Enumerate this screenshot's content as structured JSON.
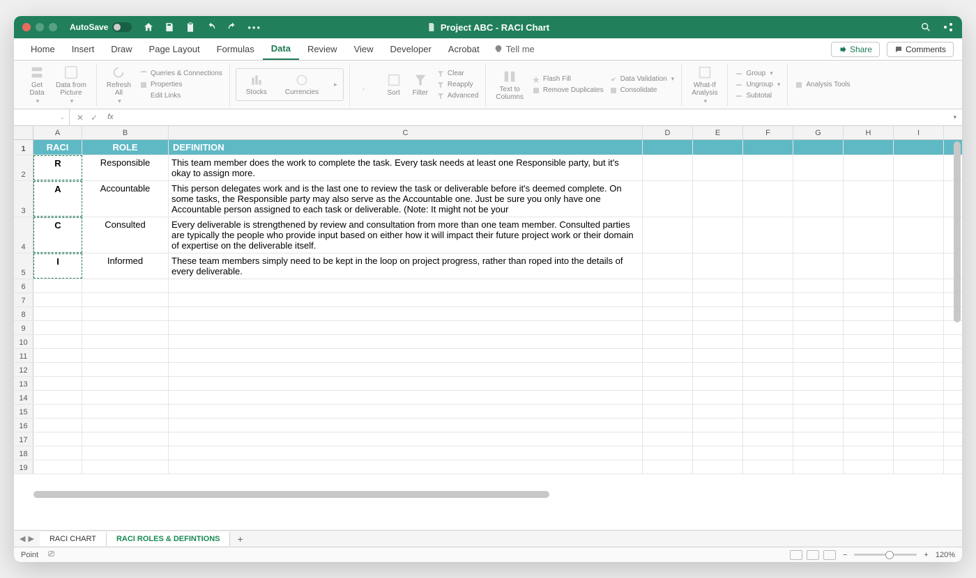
{
  "titlebar": {
    "autosave": "AutoSave",
    "title": "Project ABC - RACI Chart"
  },
  "tabs": [
    "Home",
    "Insert",
    "Draw",
    "Page Layout",
    "Formulas",
    "Data",
    "Review",
    "View",
    "Developer",
    "Acrobat"
  ],
  "active_tab": "Data",
  "tellme": "Tell me",
  "share": "Share",
  "comments": "Comments",
  "ribbon": {
    "get_data": "Get\nData",
    "from_picture": "Data from\nPicture",
    "refresh": "Refresh\nAll",
    "queries": "Queries & Connections",
    "properties": "Properties",
    "edit_links": "Edit Links",
    "stocks": "Stocks",
    "currencies": "Currencies",
    "sort": "Sort",
    "filter": "Filter",
    "clear": "Clear",
    "reapply": "Reapply",
    "advanced": "Advanced",
    "text_to_cols": "Text to\nColumns",
    "flash_fill": "Flash Fill",
    "remove_dup": "Remove Duplicates",
    "data_val": "Data Validation",
    "consolidate": "Consolidate",
    "whatif": "What-If\nAnalysis",
    "group": "Group",
    "ungroup": "Ungroup",
    "subtotal": "Subtotal",
    "analysis": "Analysis Tools"
  },
  "columns": [
    "A",
    "B",
    "C",
    "D",
    "E",
    "F",
    "G",
    "H",
    "I"
  ],
  "header_row": {
    "raci": "RACI",
    "role": "ROLE",
    "def": "DEFINITION"
  },
  "rows": [
    {
      "raci": "R",
      "role": "Responsible",
      "def": "This team member does the work to complete the task. Every task needs at least one Responsible party, but it's okay to assign more."
    },
    {
      "raci": "A",
      "role": "Accountable",
      "def": "This person delegates work and is the last one to review the task or deliverable before it's deemed complete. On some tasks, the Responsible party may also serve as the Accountable one. Just be sure you only have one Accountable person assigned to each task or deliverable. (Note: It might not be your"
    },
    {
      "raci": "C",
      "role": "Consulted",
      "def": "Every deliverable is strengthened by review and consultation from more than one team member. Consulted parties are typically the people who provide input based on either how it will impact their future project work or their domain of expertise on the deliverable itself."
    },
    {
      "raci": "I",
      "role": "Informed",
      "def": "These team members simply need to be kept in the loop on project progress, rather than roped into the details of every deliverable."
    }
  ],
  "sheets": [
    "RACI CHART",
    "RACI ROLES & DEFINTIONS"
  ],
  "active_sheet": "RACI ROLES & DEFINTIONS",
  "status_mode": "Point",
  "zoom": "120%"
}
